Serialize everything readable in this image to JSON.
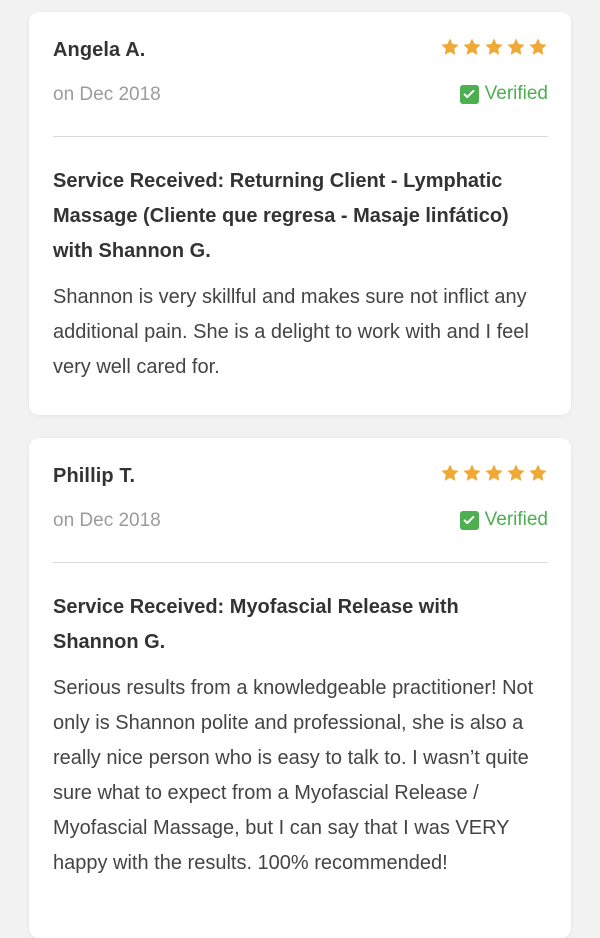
{
  "colors": {
    "accent_star": "#f0a935",
    "verified": "#4caf50",
    "divider": "#d9d9d9"
  },
  "reviews": [
    {
      "name": "Angela A.",
      "date": "on Dec 2018",
      "rating": 5,
      "verified_label": "Verified",
      "service": "Service Received: Returning Client - Lymphatic Massage (Cliente que regresa - Masaje linfático) with Shannon G.",
      "text": "Shannon is very skillful and makes sure not inflict any additional pain. She is a delight to work with and I feel very well cared for."
    },
    {
      "name": "Phillip T.",
      "date": "on Dec 2018",
      "rating": 5,
      "verified_label": "Verified",
      "service": "Service Received: Myofascial Release with Shannon G.",
      "text": "Serious results from a knowledgeable practitioner! Not only is Shannon polite and professional, she is also a really nice person who is easy to talk to. I wasn’t quite sure what to expect from a Myofascial Release / Myofascial Massage, but I can say that I was VERY happy with the results. 100% recommended!"
    }
  ]
}
